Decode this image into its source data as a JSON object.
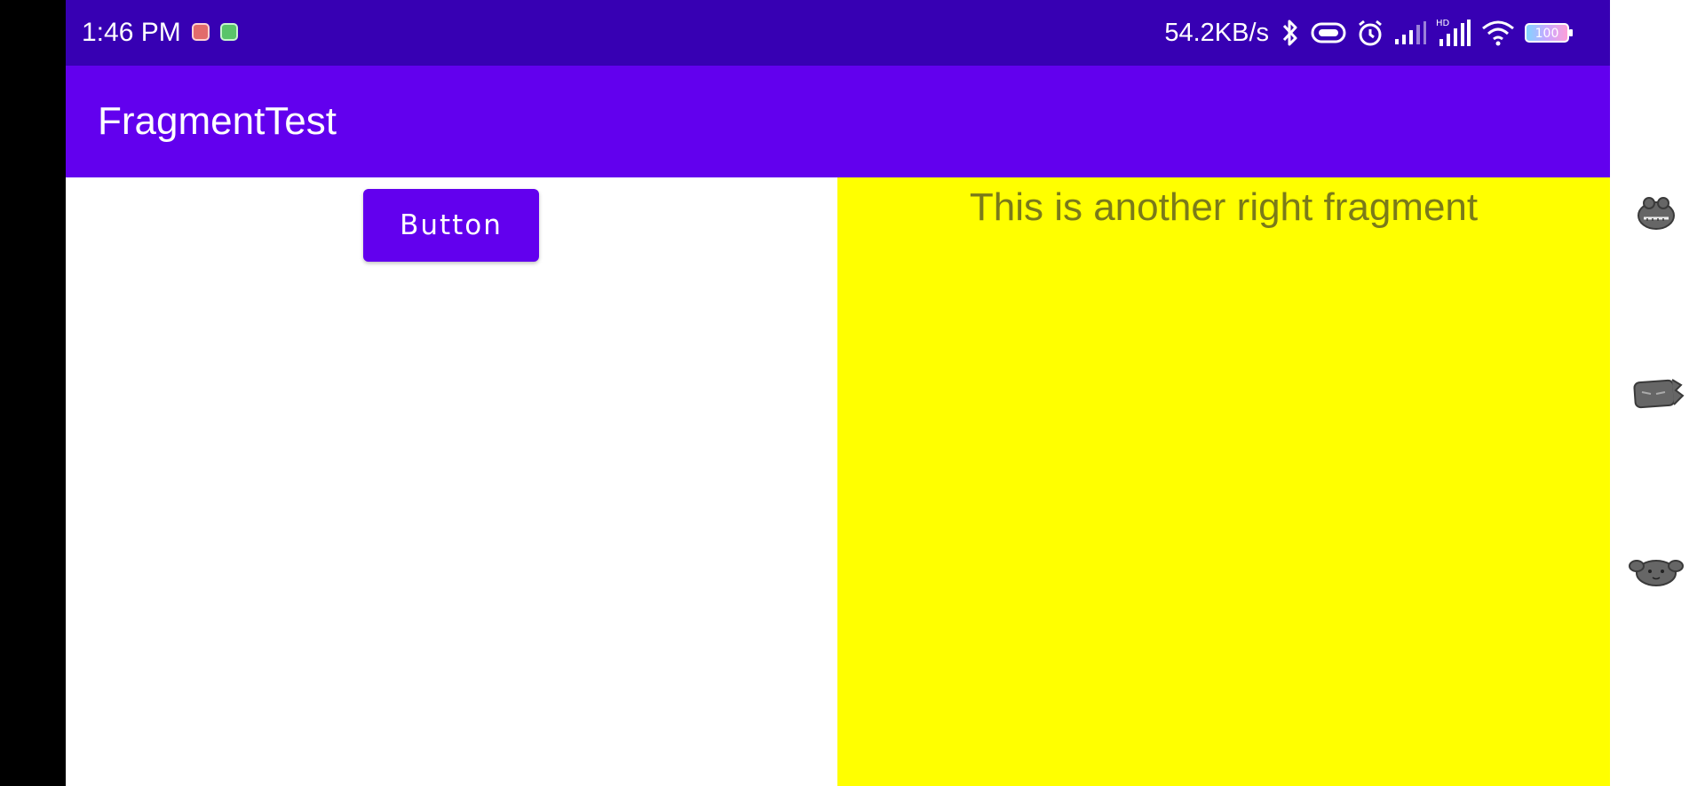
{
  "status_bar": {
    "time": "1:46 PM",
    "net_speed": "54.2KB/s",
    "icons": [
      "bluetooth-icon",
      "link-icon",
      "alarm-icon",
      "signal-icon",
      "hd-signal-icon",
      "wifi-icon",
      "battery-icon"
    ],
    "battery_level": "100"
  },
  "app_bar": {
    "title": "FragmentTest"
  },
  "left_fragment": {
    "button_label": "Button"
  },
  "right_fragment": {
    "text": "This is another right fragment",
    "background": "#ffff00"
  },
  "colors": {
    "status_bar": "#3700b3",
    "app_bar": "#6200ee",
    "button": "#6200ee"
  },
  "edge_panel": {
    "stickers": [
      "frog-sticker-icon",
      "cat-sticker-icon",
      "dog-sticker-icon"
    ]
  }
}
